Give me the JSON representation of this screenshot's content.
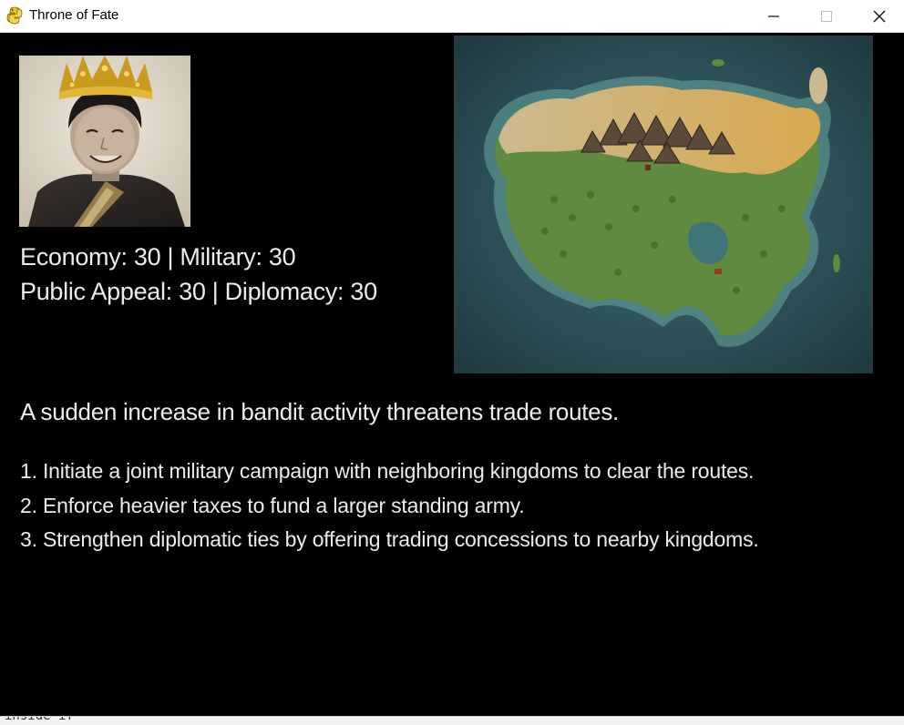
{
  "window": {
    "title": "Throne of Fate",
    "icon": "pygame-snake-icon",
    "minimize_icon": "minimize-icon",
    "maximize_icon": "maximize-icon",
    "close_icon": "close-icon"
  },
  "stats": {
    "line1": "Economy: 30 | Military: 30",
    "line2": "Public Appeal: 30 | Diplomacy: 30",
    "economy": 30,
    "military": 30,
    "public_appeal": 30,
    "diplomacy": 30
  },
  "event": {
    "text": "A sudden increase in bandit activity threatens trade routes."
  },
  "options": [
    {
      "label": "1. Initiate a joint military campaign with neighboring kingdoms to clear the routes."
    },
    {
      "label": "2. Enforce heavier taxes to fund a larger standing army."
    },
    {
      "label": "3. Strengthen diplomatic ties by offering trading concessions to nearby kingdoms."
    }
  ],
  "console": {
    "text": "inside if"
  },
  "colors": {
    "background": "#000000",
    "text": "#ececec",
    "sea": "#2d4f57",
    "land_green": "#5f8a3f",
    "land_tan": "#cfb17a"
  }
}
